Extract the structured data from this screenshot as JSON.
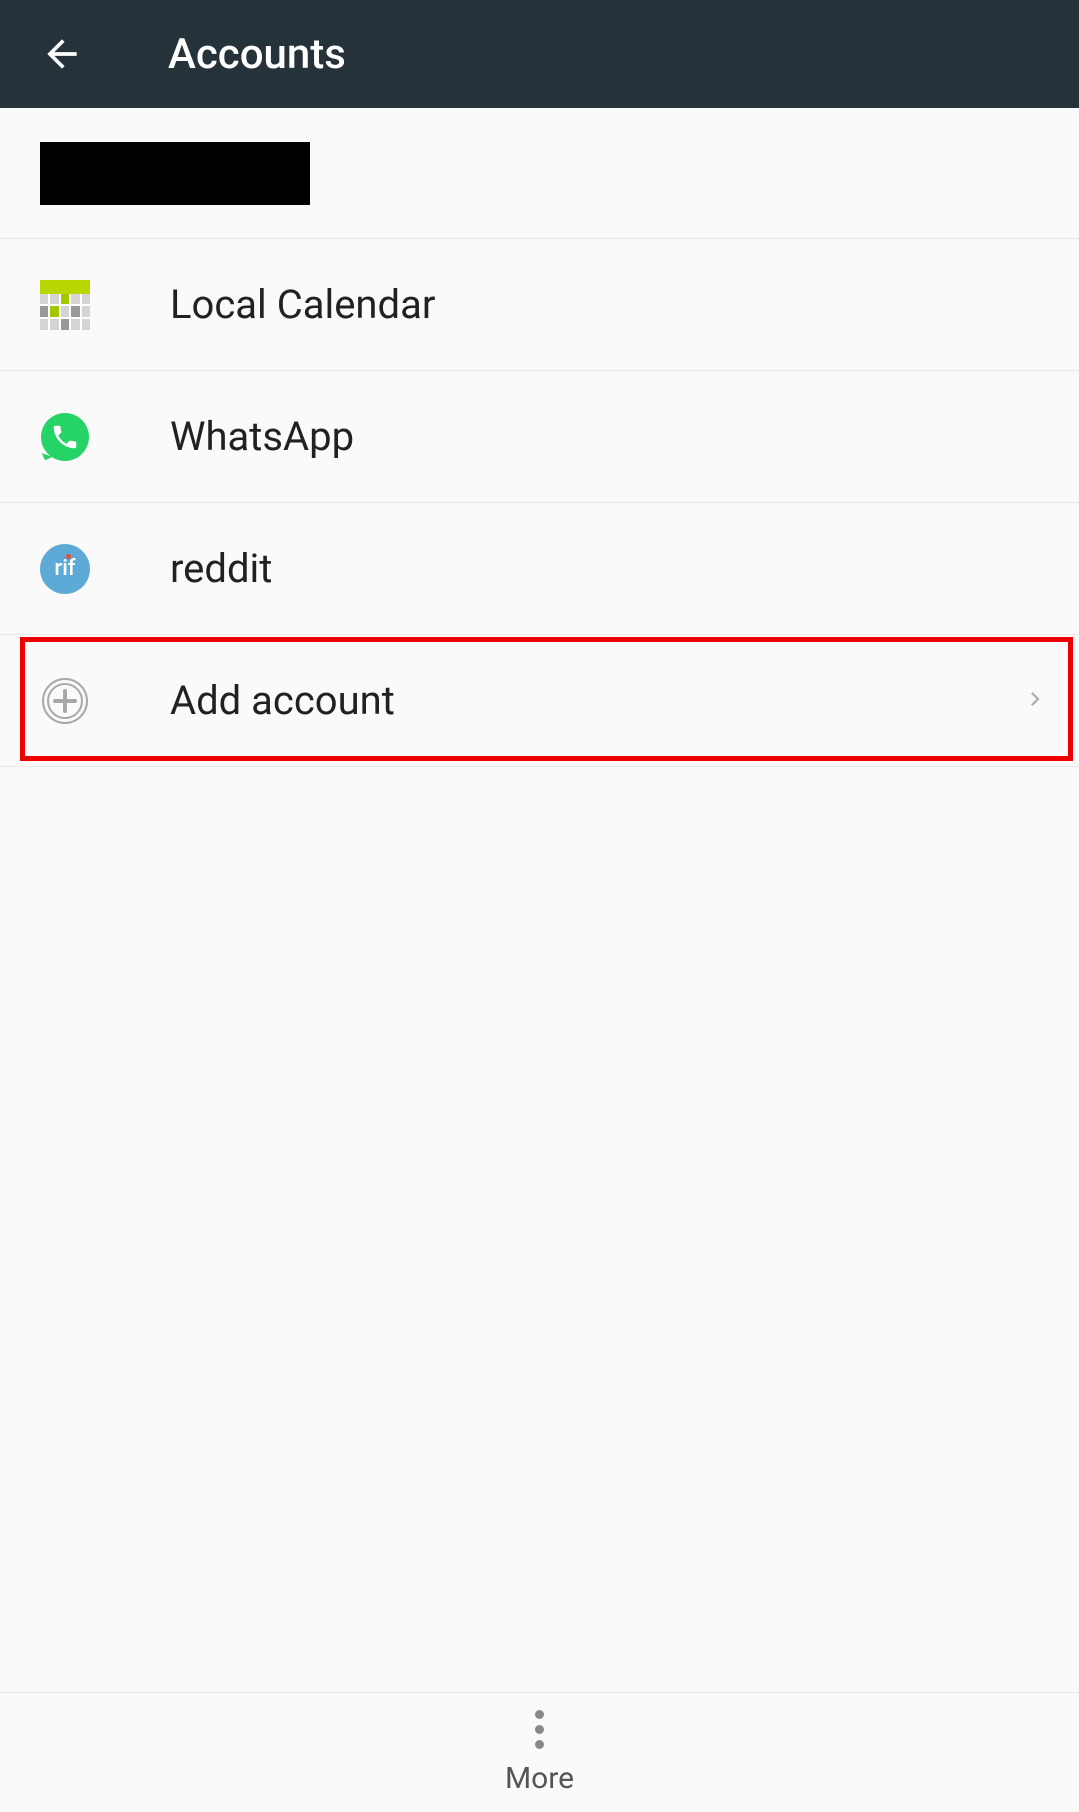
{
  "header": {
    "title": "Accounts"
  },
  "accounts": [
    {
      "label": "Local Calendar",
      "icon": "calendar"
    },
    {
      "label": "WhatsApp",
      "icon": "whatsapp"
    },
    {
      "label": "reddit",
      "icon": "rif",
      "icon_text": "rif"
    }
  ],
  "add_account": {
    "label": "Add account"
  },
  "bottom": {
    "more_label": "More"
  }
}
